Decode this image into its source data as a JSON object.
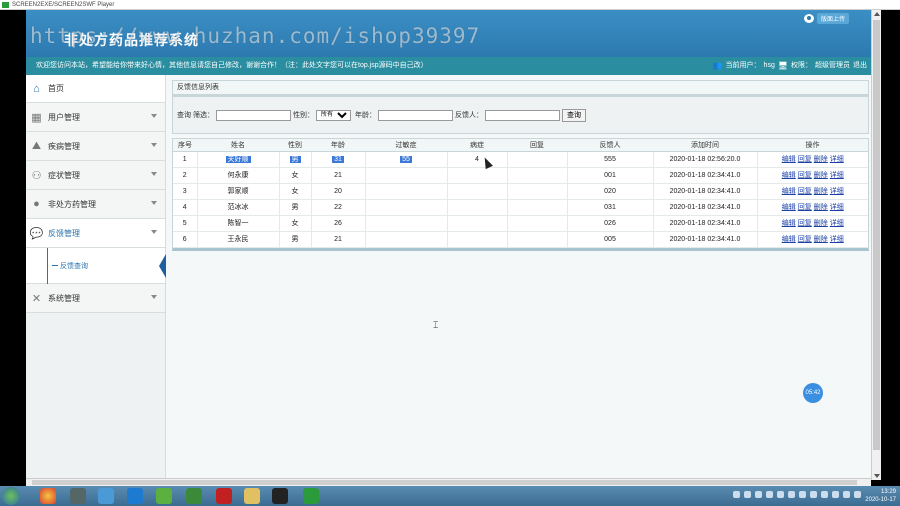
{
  "window": {
    "title": "SCREEN2EXE/SCREEN2SWF Player"
  },
  "header": {
    "system_title": "非处方药品推荐系统",
    "help_label": "版面上传",
    "watermark": "https://www.huzhan.com/ishop39397"
  },
  "notice_bar": {
    "notice": "欢迎您访问本站，希望能给你带来好心情，其他信息请您自己修改，谢谢合作！（注：此处文字您可以在top.jsp源码中自己改）",
    "current_user_label": "当前用户：",
    "current_user": "hsg",
    "role_label": "权限：",
    "role": "超级管理员",
    "logout": "退出"
  },
  "sidebar": {
    "home": "首页",
    "items": [
      {
        "label": "用户管理",
        "icon": "grid-icon"
      },
      {
        "label": "疾病管理",
        "icon": "mountain-icon"
      },
      {
        "label": "症状管理",
        "icon": "users-icon"
      },
      {
        "label": "非处方药管理",
        "icon": "person-icon"
      },
      {
        "label": "反馈管理",
        "icon": "chat-icon"
      }
    ],
    "sub_items": [
      "反馈查询"
    ],
    "system": {
      "label": "系统管理",
      "icon": "tools-icon"
    }
  },
  "main": {
    "list_title": "反馈信息列表",
    "search": {
      "filter_label": "查询 筛选：",
      "gender_label": "性别：",
      "gender_value": "所有",
      "age_label": "年龄：",
      "feedback_person_label": "反馈人：",
      "search_button": "查询"
    },
    "table": {
      "columns": [
        "序号",
        "姓名",
        "性别",
        "年龄",
        "过敏症",
        "病症",
        "回复",
        "反馈人",
        "添加时间",
        "操作"
      ],
      "rows": [
        {
          "no": "1",
          "name": "关好顺",
          "gender": "男",
          "age": "31",
          "allergy": "55",
          "symptom": "4",
          "reply": "",
          "person": "555",
          "time": "2020-01-18 02:56:20.0"
        },
        {
          "no": "2",
          "name": "何永康",
          "gender": "女",
          "age": "21",
          "allergy": "",
          "symptom": "",
          "reply": "",
          "person": "001",
          "time": "2020-01-18 02:34:41.0"
        },
        {
          "no": "3",
          "name": "郭家顺",
          "gender": "女",
          "age": "20",
          "allergy": "",
          "symptom": "",
          "reply": "",
          "person": "020",
          "time": "2020-01-18 02:34:41.0"
        },
        {
          "no": "4",
          "name": "范冰冰",
          "gender": "男",
          "age": "22",
          "allergy": "",
          "symptom": "",
          "reply": "",
          "person": "031",
          "time": "2020-01-18 02:34:41.0"
        },
        {
          "no": "5",
          "name": "陈智一",
          "gender": "女",
          "age": "26",
          "allergy": "",
          "symptom": "",
          "reply": "",
          "person": "026",
          "time": "2020-01-18 02:34:41.0"
        },
        {
          "no": "6",
          "name": "王永民",
          "gender": "男",
          "age": "21",
          "allergy": "",
          "symptom": "",
          "reply": "",
          "person": "005",
          "time": "2020-01-18 02:34:41.0"
        }
      ],
      "ops": [
        "编辑",
        "回复",
        "删除",
        "详细"
      ]
    }
  },
  "timer": "05:42",
  "tray": {
    "time": "13:29",
    "date": "2020-10-17"
  }
}
